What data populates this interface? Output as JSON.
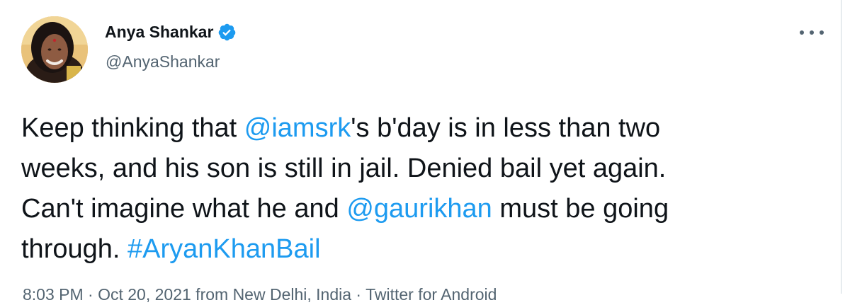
{
  "author": {
    "display_name": "Anya Shankar",
    "handle": "@AnyaShankar",
    "verified": true
  },
  "icons": {
    "verified": "verified-badge-icon",
    "more": "more-options-icon"
  },
  "colors": {
    "link": "#1d9bf0",
    "verified": "#1d9bf0",
    "secondary_text": "#536471",
    "primary_text": "#0f1419"
  },
  "tweet": {
    "lines": [
      [
        {
          "text": "Keep thinking that ",
          "type": "text"
        },
        {
          "text": "@iamsrk",
          "type": "mention"
        },
        {
          "text": "'s b'day is in less than two",
          "type": "text"
        }
      ],
      [
        {
          "text": "weeks, and his son is still in jail. Denied bail yet again.",
          "type": "text"
        }
      ],
      [
        {
          "text": "Can't imagine what he and ",
          "type": "text"
        },
        {
          "text": "@gaurikhan",
          "type": "mention"
        },
        {
          "text": " must be going",
          "type": "text"
        }
      ],
      [
        {
          "text": "through. ",
          "type": "text"
        },
        {
          "text": "#AryanKhanBail",
          "type": "hashtag"
        }
      ]
    ]
  },
  "meta": {
    "text": "8:03 PM · Oct 20, 2021 from New Delhi, India · Twitter for Android"
  }
}
